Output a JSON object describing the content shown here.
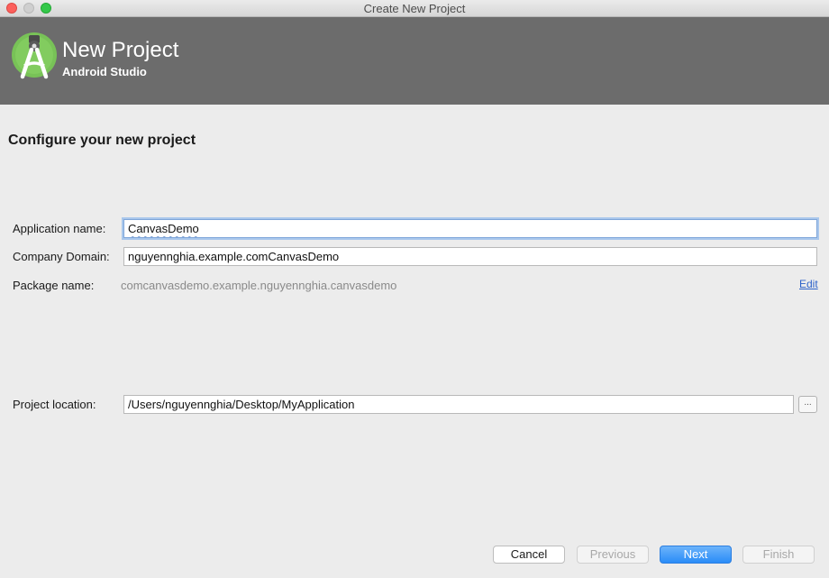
{
  "window": {
    "title": "Create New Project"
  },
  "banner": {
    "title": "New Project",
    "subtitle": "Android Studio",
    "logo_icon": "android-studio-icon"
  },
  "page": {
    "heading": "Configure your new project"
  },
  "form": {
    "app_name": {
      "label": "Application name:",
      "value": "CanvasDemo"
    },
    "company_domain": {
      "label": "Company Domain:",
      "value": "nguyennghia.example.comCanvasDemo"
    },
    "package_name": {
      "label": "Package name:",
      "value": "comcanvasdemo.example.nguyennghia.canvasdemo",
      "edit_label": "Edit"
    },
    "project_location": {
      "label": "Project location:",
      "value": "/Users/nguyennghia/Desktop/MyApplication",
      "browse_label": "..."
    }
  },
  "buttons": {
    "cancel": "Cancel",
    "previous": "Previous",
    "next": "Next",
    "finish": "Finish"
  },
  "colors": {
    "banner": "#6c6c6c",
    "logo_green": "#78c257",
    "primary_button": "#2a8cf8",
    "link": "#2b61c9"
  }
}
